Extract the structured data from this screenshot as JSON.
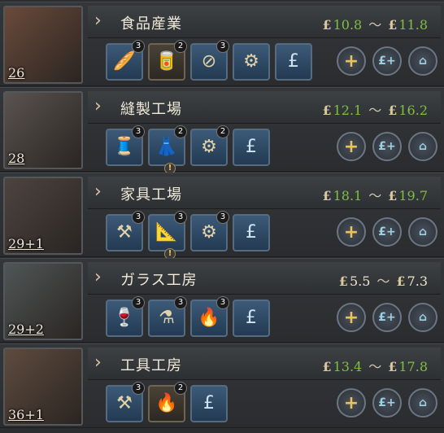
{
  "currency_symbol": "£",
  "tilde": "～",
  "buttons": {
    "add": "+",
    "money": "£+",
    "home": "⌂"
  },
  "industries": [
    {
      "title": "食品産業",
      "count": "26",
      "price_low": "10.8",
      "price_high": "11.8",
      "price_color": "green",
      "slots": [
        {
          "icon": "bread-icon",
          "glyph": "🥖",
          "badge": "3",
          "style": "blue"
        },
        {
          "icon": "canned-food-icon",
          "glyph": "🥫",
          "badge": "2",
          "style": "brown"
        },
        {
          "icon": "no-alcohol-icon",
          "glyph": "⊘",
          "badge": "3",
          "style": "blue"
        },
        {
          "icon": "production-method-gear-icon",
          "glyph": "⚙",
          "badge": "",
          "style": "blue"
        },
        {
          "icon": "wage-pound-icon",
          "glyph": "£",
          "badge": "",
          "style": "blue"
        }
      ]
    },
    {
      "title": "縫製工場",
      "count": "28",
      "price_low": "12.1",
      "price_high": "16.2",
      "price_color": "green",
      "slots": [
        {
          "icon": "sewing-machine-icon",
          "glyph": "🧵",
          "badge": "3",
          "style": "blue"
        },
        {
          "icon": "dress-form-icon",
          "glyph": "👗",
          "badge": "2",
          "style": "blue",
          "warn": true
        },
        {
          "icon": "production-method-gear-icon",
          "glyph": "⚙",
          "badge": "2",
          "style": "blue"
        },
        {
          "icon": "wage-pound-icon",
          "glyph": "£",
          "badge": "",
          "style": "blue"
        }
      ]
    },
    {
      "title": "家具工場",
      "count": "29+1",
      "price_low": "18.1",
      "price_high": "19.7",
      "price_color": "green",
      "slots": [
        {
          "icon": "tools-gear-icon",
          "glyph": "⚒",
          "badge": "3",
          "style": "blue"
        },
        {
          "icon": "compass-icon",
          "glyph": "📐",
          "badge": "3",
          "style": "blue",
          "warn": true
        },
        {
          "icon": "production-method-gear-icon",
          "glyph": "⚙",
          "badge": "3",
          "style": "blue"
        },
        {
          "icon": "wage-pound-icon",
          "glyph": "£",
          "badge": "",
          "style": "blue"
        }
      ]
    },
    {
      "title": "ガラス工房",
      "count": "29+2",
      "price_low": "5.5",
      "price_high": "7.3",
      "price_color": "white",
      "slots": [
        {
          "icon": "glass-goblet-icon",
          "glyph": "🍷",
          "badge": "3",
          "style": "blue"
        },
        {
          "icon": "flask-icon",
          "glyph": "⚗",
          "badge": "3",
          "style": "blue"
        },
        {
          "icon": "glassblowing-icon",
          "glyph": "🔥",
          "badge": "3",
          "style": "blue"
        },
        {
          "icon": "wage-pound-icon",
          "glyph": "£",
          "badge": "",
          "style": "blue"
        }
      ]
    },
    {
      "title": "工具工房",
      "count": "36+1",
      "price_low": "13.4",
      "price_high": "17.8",
      "price_color": "green",
      "slots": [
        {
          "icon": "anvil-icon",
          "glyph": "⚒",
          "badge": "3",
          "style": "blue"
        },
        {
          "icon": "furnace-gear-icon",
          "glyph": "🔥",
          "badge": "2",
          "style": "brown"
        },
        {
          "icon": "wage-pound-icon",
          "glyph": "£",
          "badge": "",
          "style": "blue"
        }
      ]
    }
  ],
  "thumb_colors": [
    "#6a4a3a",
    "#5a5350",
    "#4d4440",
    "#4f5656",
    "#5f4b3e"
  ]
}
